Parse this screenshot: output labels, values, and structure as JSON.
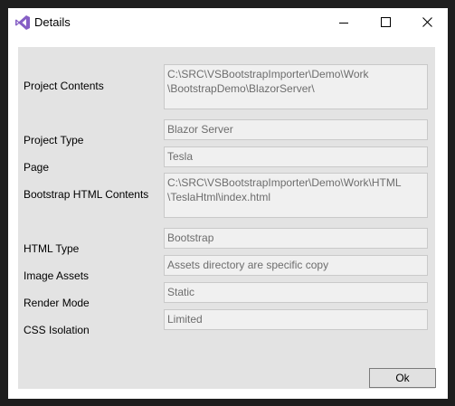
{
  "window": {
    "title": "Details",
    "icon": "visual-studio-icon",
    "controls": {
      "minimize": "minimize-icon",
      "maximize": "maximize-icon",
      "close": "close-icon"
    }
  },
  "details": [
    {
      "label": "Project Contents",
      "value": "C:\\SRC\\VSBootstrapImporter\\Demo\\Work\n\\BootstrapDemo\\BlazorServer\\"
    },
    {
      "label": "Project Type",
      "value": "Blazor Server"
    },
    {
      "label": "Page",
      "value": "Tesla"
    },
    {
      "label": "Bootstrap HTML Contents",
      "value": "C:\\SRC\\VSBootstrapImporter\\Demo\\Work\\HTML\n\\TeslaHtml\\index.html"
    },
    {
      "label": "HTML Type",
      "value": "Bootstrap"
    },
    {
      "label": "Image Assets",
      "value": "Assets directory are specific copy"
    },
    {
      "label": "Render Mode",
      "value": "Static"
    },
    {
      "label": "CSS Isolation",
      "value": "Limited"
    }
  ],
  "ok_button": {
    "label": "Ok"
  },
  "colors": {
    "window_bg": "#ffffff",
    "client_bg": "#e3e3e3",
    "field_bg": "#f0f0f0",
    "field_text": "#6d6d6d",
    "vs_purple": "#865fc5"
  }
}
